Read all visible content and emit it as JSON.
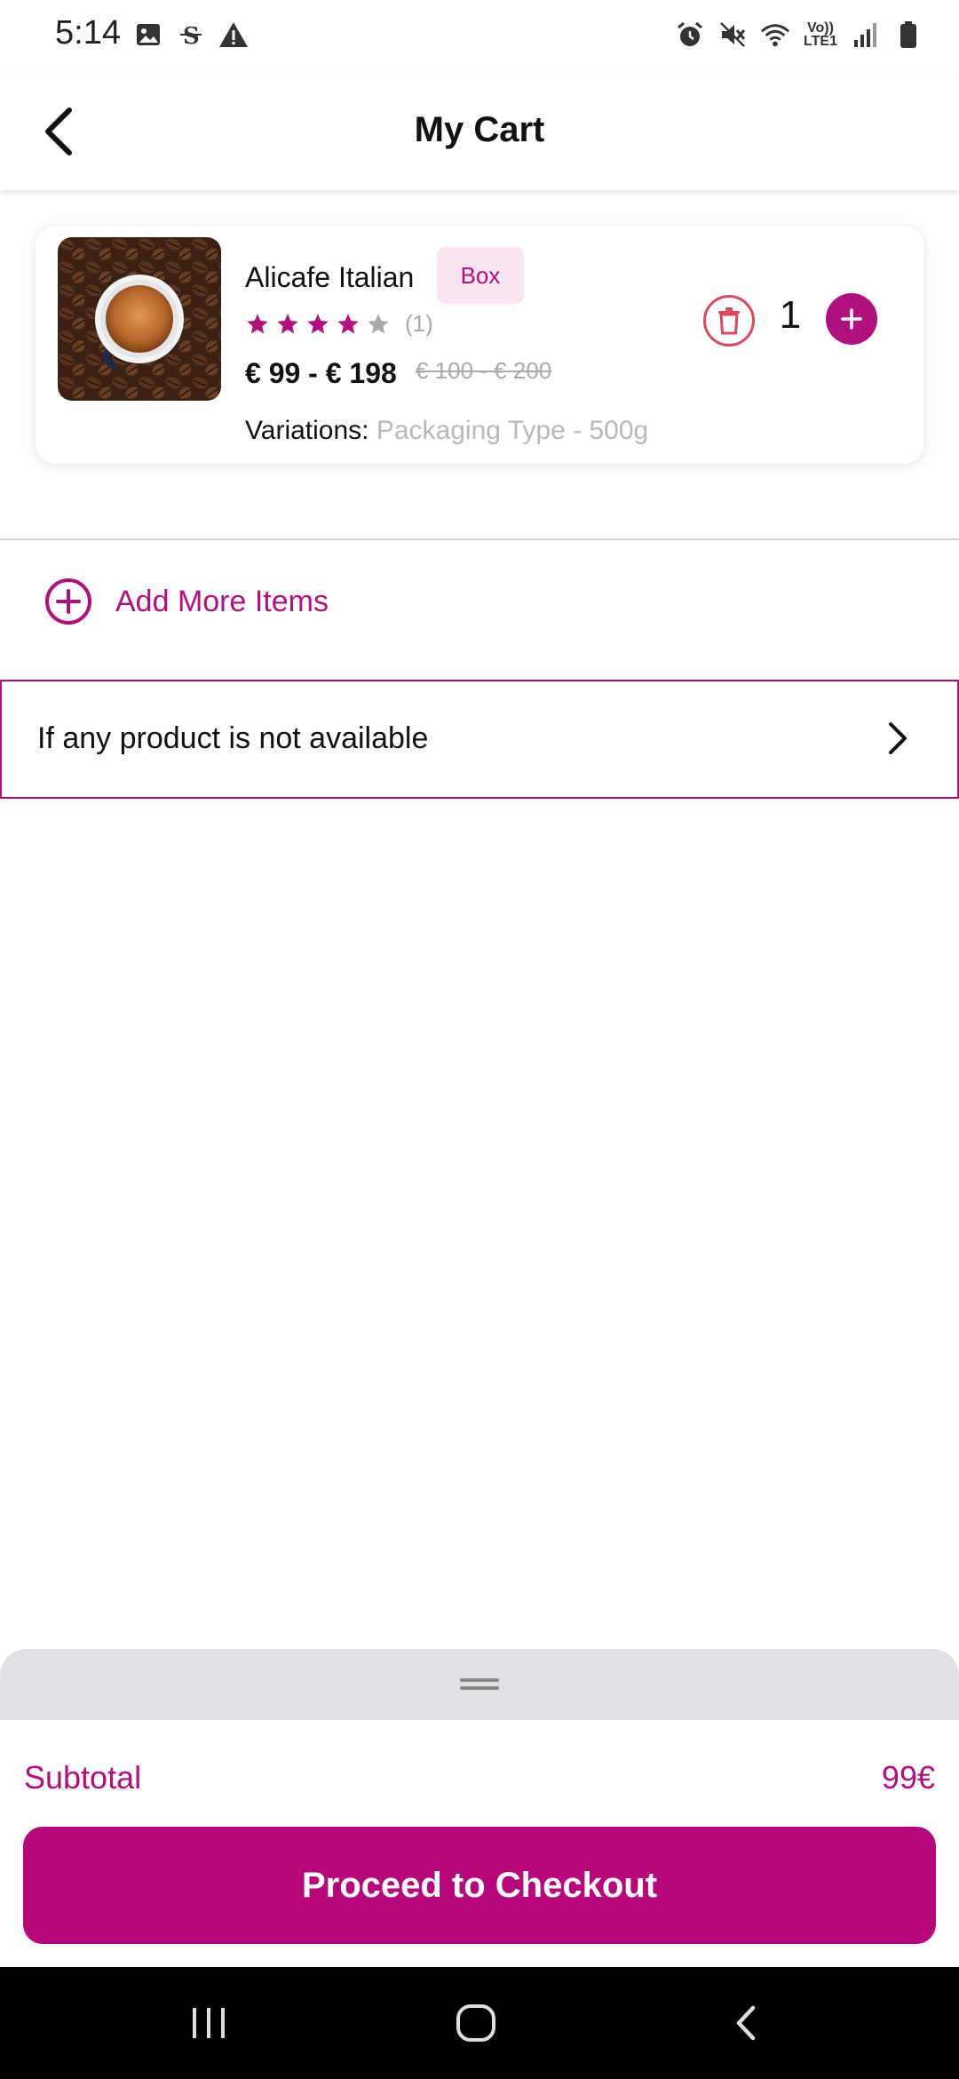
{
  "status_bar": {
    "time": "5:14",
    "left_icons": [
      "image-icon",
      "s-icon",
      "warning-icon"
    ],
    "right_icons": [
      "alarm-icon",
      "mute-icon",
      "wifi-icon",
      "volte-icon",
      "signal-icon",
      "battery-icon"
    ],
    "volte_line1": "Vo))",
    "volte_line2": "LTE1"
  },
  "header": {
    "title": "My Cart"
  },
  "cart": {
    "items": [
      {
        "name": "Alicafe Italian",
        "tag": "Box",
        "rating": 4,
        "rating_max": 5,
        "rating_count": "(1)",
        "price": "€ 99 - € 198",
        "old_price": "€ 100 - € 200",
        "variations_label": "Variations:",
        "variations_value": "Packaging Type - 500g",
        "quantity": "1"
      }
    ]
  },
  "actions": {
    "add_more_label": "Add More Items",
    "unavailable_label": "If any product is not available"
  },
  "summary": {
    "subtotal_label": "Subtotal",
    "subtotal_value": "99€",
    "checkout_label": "Proceed to Checkout"
  },
  "colors": {
    "accent": "#b0107b",
    "badge_bg": "#fbe4f1",
    "delete": "#d94a5b",
    "star_empty": "#a9a9a9"
  }
}
